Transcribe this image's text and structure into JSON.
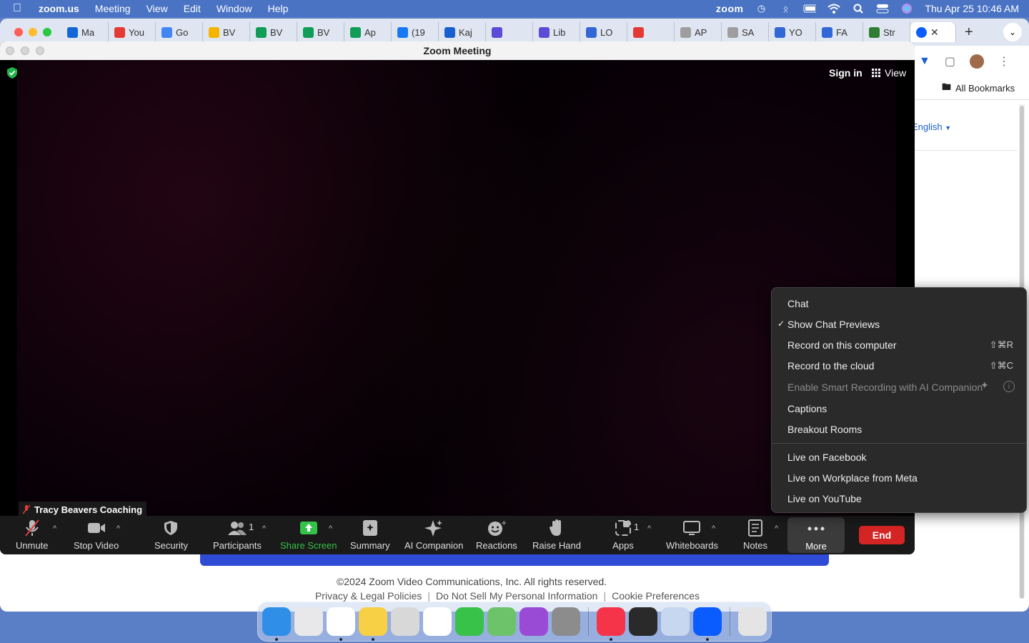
{
  "menubar": {
    "app": "zoom.us",
    "items": [
      "Meeting",
      "View",
      "Edit",
      "Window",
      "Help"
    ],
    "status_zoom": "zoom",
    "datetime": "Thu Apr 25  10:46 AM"
  },
  "chrome": {
    "tabs": [
      {
        "label": "Ma",
        "color": "#1366d6"
      },
      {
        "label": "You",
        "color": "#e53935"
      },
      {
        "label": "Go",
        "color": "#4285f4"
      },
      {
        "label": "BV",
        "color": "#f4b400"
      },
      {
        "label": "BV",
        "color": "#0f9d58"
      },
      {
        "label": "BV",
        "color": "#0f9d58"
      },
      {
        "label": "Ap",
        "color": "#0f9d58"
      },
      {
        "label": "(19",
        "color": "#1877f2"
      },
      {
        "label": "Kaj",
        "color": "#1a5fd0"
      },
      {
        "label": "",
        "color": "#5b4bd6"
      },
      {
        "label": "Lib",
        "color": "#5b4bd6"
      },
      {
        "label": "LO",
        "color": "#3367d6"
      },
      {
        "label": "",
        "color": "#e53935"
      },
      {
        "label": "AP",
        "color": "#9e9e9e"
      },
      {
        "label": "SA",
        "color": "#9e9e9e"
      },
      {
        "label": "YO",
        "color": "#3367d6"
      },
      {
        "label": "FA",
        "color": "#3367d6"
      },
      {
        "label": "Str",
        "color": "#2e7d32"
      }
    ],
    "all_bookmarks": "All Bookmarks",
    "language": "English",
    "copyright": "©2024 Zoom Video Communications, Inc. All rights reserved.",
    "footer_links": [
      "Privacy & Legal Policies",
      "Do Not Sell My Personal Information",
      "Cookie Preferences"
    ]
  },
  "zoom": {
    "window_title": "Zoom Meeting",
    "sign_in": "Sign in",
    "view": "View",
    "participant_name": "Tracy Beavers Coaching",
    "controls": {
      "unmute": "Unmute",
      "stop_video": "Stop Video",
      "security": "Security",
      "participants": "Participants",
      "participants_count": "1",
      "share_screen": "Share Screen",
      "summary": "Summary",
      "ai_companion": "AI Companion",
      "reactions": "Reactions",
      "raise_hand": "Raise Hand",
      "apps": "Apps",
      "apps_count": "1",
      "whiteboards": "Whiteboards",
      "notes": "Notes",
      "more": "More",
      "end": "End"
    },
    "more_menu": {
      "chat": "Chat",
      "show_chat_previews": "Show Chat Previews",
      "record_computer": "Record on this computer",
      "record_computer_shortcut": "⇧⌘R",
      "record_cloud": "Record to the cloud",
      "record_cloud_shortcut": "⇧⌘C",
      "smart_recording": "Enable Smart Recording with AI Companion",
      "captions": "Captions",
      "breakout_rooms": "Breakout Rooms",
      "live_facebook": "Live on Facebook",
      "live_workplace": "Live on Workplace from Meta",
      "live_youtube": "Live on YouTube"
    }
  },
  "dock": {
    "apps": [
      {
        "name": "finder",
        "color": "#2f8fe8",
        "running": true
      },
      {
        "name": "launchpad",
        "color": "#e8e8ea",
        "running": false
      },
      {
        "name": "chrome",
        "color": "#ffffff",
        "running": true
      },
      {
        "name": "notes",
        "color": "#f7d046",
        "running": true
      },
      {
        "name": "screenshot",
        "color": "#d8d8d8",
        "running": false
      },
      {
        "name": "photos",
        "color": "#ffffff",
        "running": false
      },
      {
        "name": "messages",
        "color": "#38c24a",
        "running": false
      },
      {
        "name": "maps",
        "color": "#6cc36a",
        "running": false
      },
      {
        "name": "podcasts",
        "color": "#9a4bd6",
        "running": false
      },
      {
        "name": "system-settings",
        "color": "#8c8c8c",
        "running": false
      },
      {
        "name": "music",
        "color": "#f5344a",
        "running": true
      },
      {
        "name": "quicktime",
        "color": "#2a2a2a",
        "running": false
      },
      {
        "name": "preview",
        "color": "#c7d7ef",
        "running": false
      },
      {
        "name": "zoom",
        "color": "#0b5cff",
        "running": true
      },
      {
        "name": "trash",
        "color": "#e4e4e4",
        "running": false
      }
    ]
  }
}
